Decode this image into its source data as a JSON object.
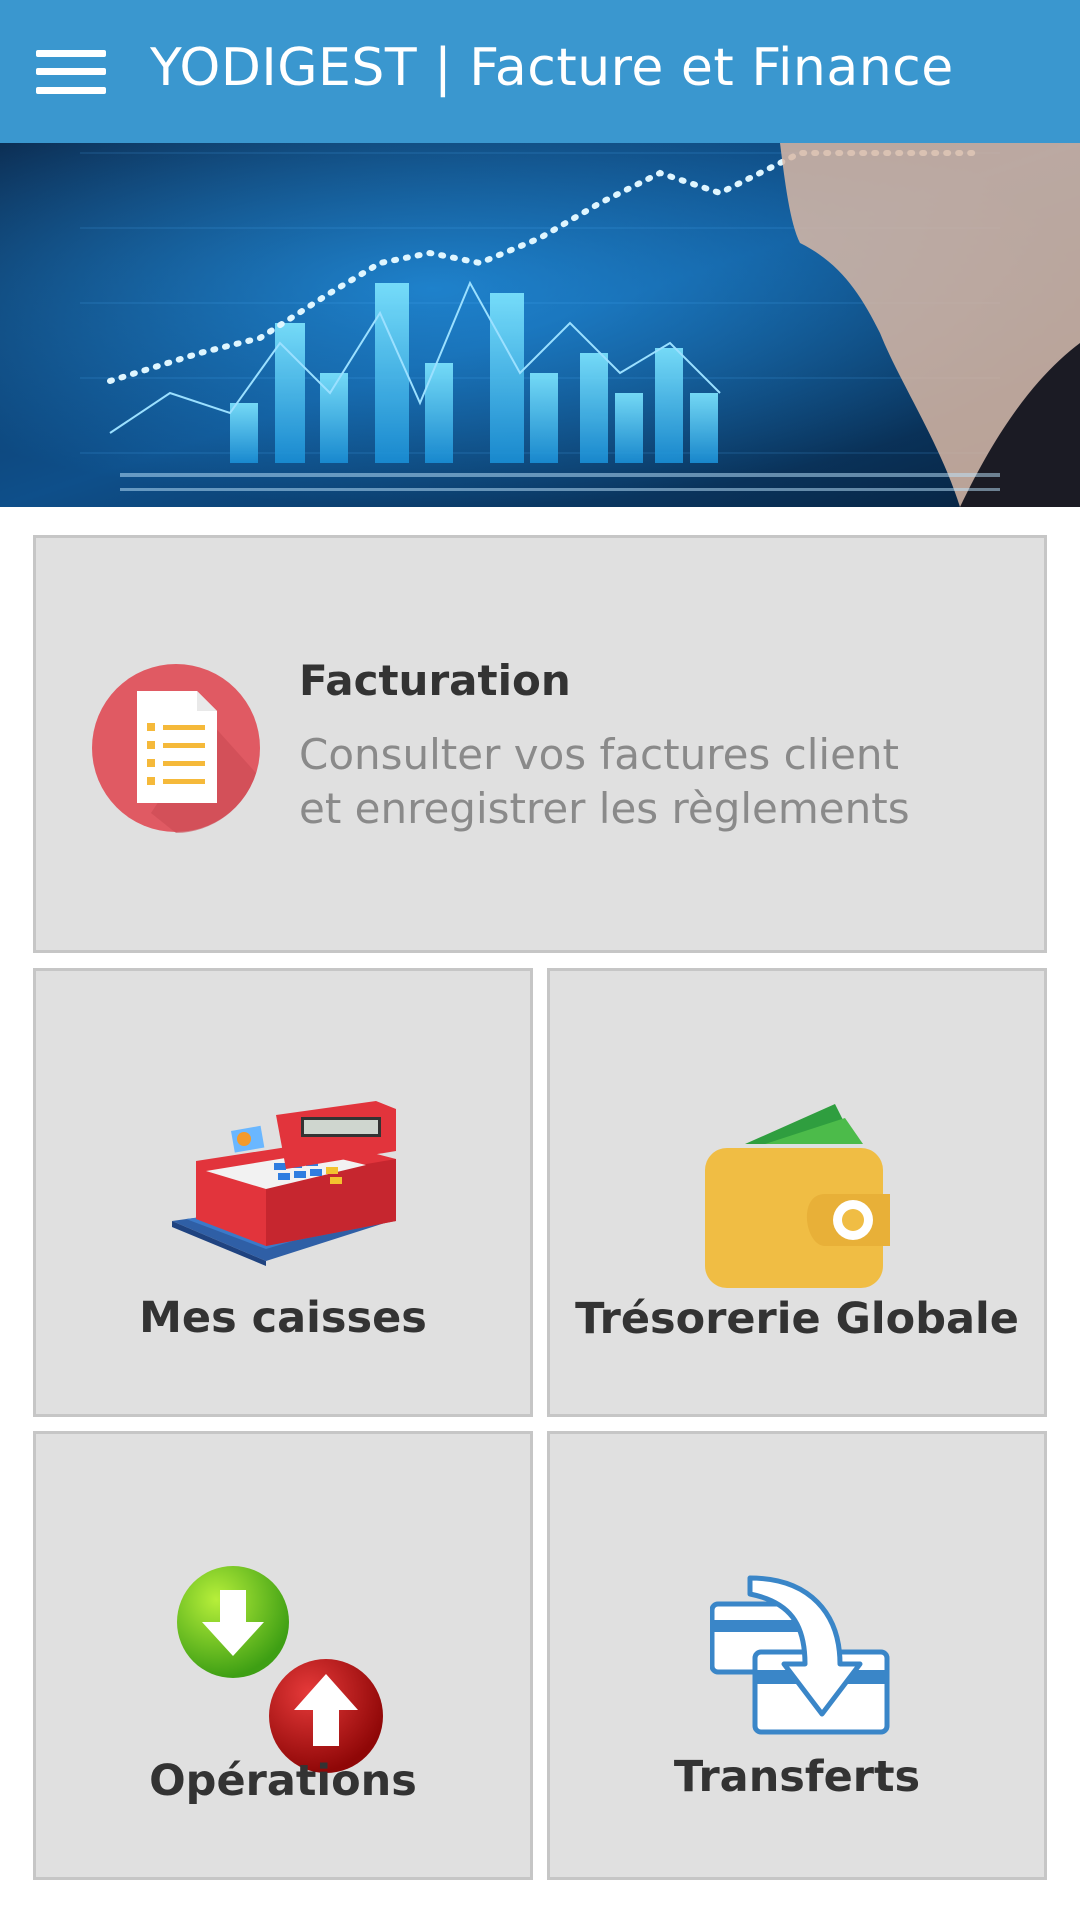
{
  "appbar": {
    "title": "YODIGEST | Facture et Finance",
    "menu_icon": "hamburger-menu-icon"
  },
  "hero": {
    "description_icon": "finance-chart-banner"
  },
  "tiles": {
    "facturation": {
      "title": "Facturation",
      "desc_line1": "Consulter vos factures client",
      "desc_line2": "et enregistrer les règlements",
      "icon": "invoice-icon"
    },
    "caisses": {
      "label": "Mes caisses",
      "icon": "cash-register-icon"
    },
    "tresorerie": {
      "label": "Trésorerie Globale",
      "icon": "wallet-icon"
    },
    "operations": {
      "label": "Opérations",
      "icon": "in-out-arrows-icon"
    },
    "transferts": {
      "label": "Transferts",
      "icon": "transfer-cards-icon"
    }
  },
  "colors": {
    "appbar": "#3a97cf",
    "tile_bg": "#e0e0e0",
    "invoice_red": "#e05a63",
    "wallet_yellow": "#f0bd44"
  }
}
